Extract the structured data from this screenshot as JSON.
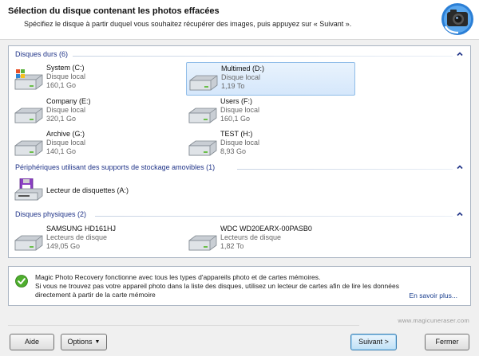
{
  "header": {
    "title": "Sélection du disque contenant les photos effacées",
    "subtitle": "Spécifiez le disque à partir duquel vous souhaitez récupérer des images, puis appuyez sur « Suivant »."
  },
  "groups": {
    "hard_disks": {
      "label": "Disques durs (6)",
      "items": [
        {
          "name": "System (C:)",
          "type": "Disque local",
          "size": "160,1 Go",
          "selected": false
        },
        {
          "name": "Multimed (D:)",
          "type": "Disque local",
          "size": "1,19 To",
          "selected": true
        },
        {
          "name": "Company (E:)",
          "type": "Disque local",
          "size": "320,1 Go",
          "selected": false
        },
        {
          "name": "Users (F:)",
          "type": "Disque local",
          "size": "160,1 Go",
          "selected": false
        },
        {
          "name": "Archive (G:)",
          "type": "Disque local",
          "size": "140,1 Go",
          "selected": false
        },
        {
          "name": "TEST (H:)",
          "type": "Disque local",
          "size": "8,93 Go",
          "selected": false
        }
      ]
    },
    "removable": {
      "label": "Périphériques utilisant des supports de stockage amovibles (1)",
      "items": [
        {
          "name": "Lecteur de disquettes (A:)"
        }
      ]
    },
    "physical": {
      "label": "Disques physiques (2)",
      "items": [
        {
          "name": "SAMSUNG HD161HJ",
          "type": "Lecteurs de disque",
          "size": "149,05 Go"
        },
        {
          "name": "WDC WD20EARX-00PASB0",
          "type": "Lecteurs de disque",
          "size": "1,82 To"
        }
      ]
    }
  },
  "info": {
    "line1": "Magic Photo Recovery fonctionne avec tous les types d'appareils photo et de cartes mémoires.",
    "line2": "Si vous ne trouvez pas votre appareil photo dans la liste des disques, utilisez un lecteur de cartes afin de lire les données",
    "line3": "directement à partir de la carte mémoire",
    "learn_more": "En savoir plus..."
  },
  "site": "www.magicuneraser.com",
  "buttons": {
    "help": "Aide",
    "options": "Options",
    "next": "Suivant >",
    "close": "Fermer"
  },
  "icons": {
    "header": "camera-icon",
    "disk": "hard-disk-icon",
    "system_disk": "windows-hard-disk-icon",
    "floppy": "floppy-drive-icon",
    "info": "check-icon",
    "collapse": "chevron-up-icon"
  }
}
